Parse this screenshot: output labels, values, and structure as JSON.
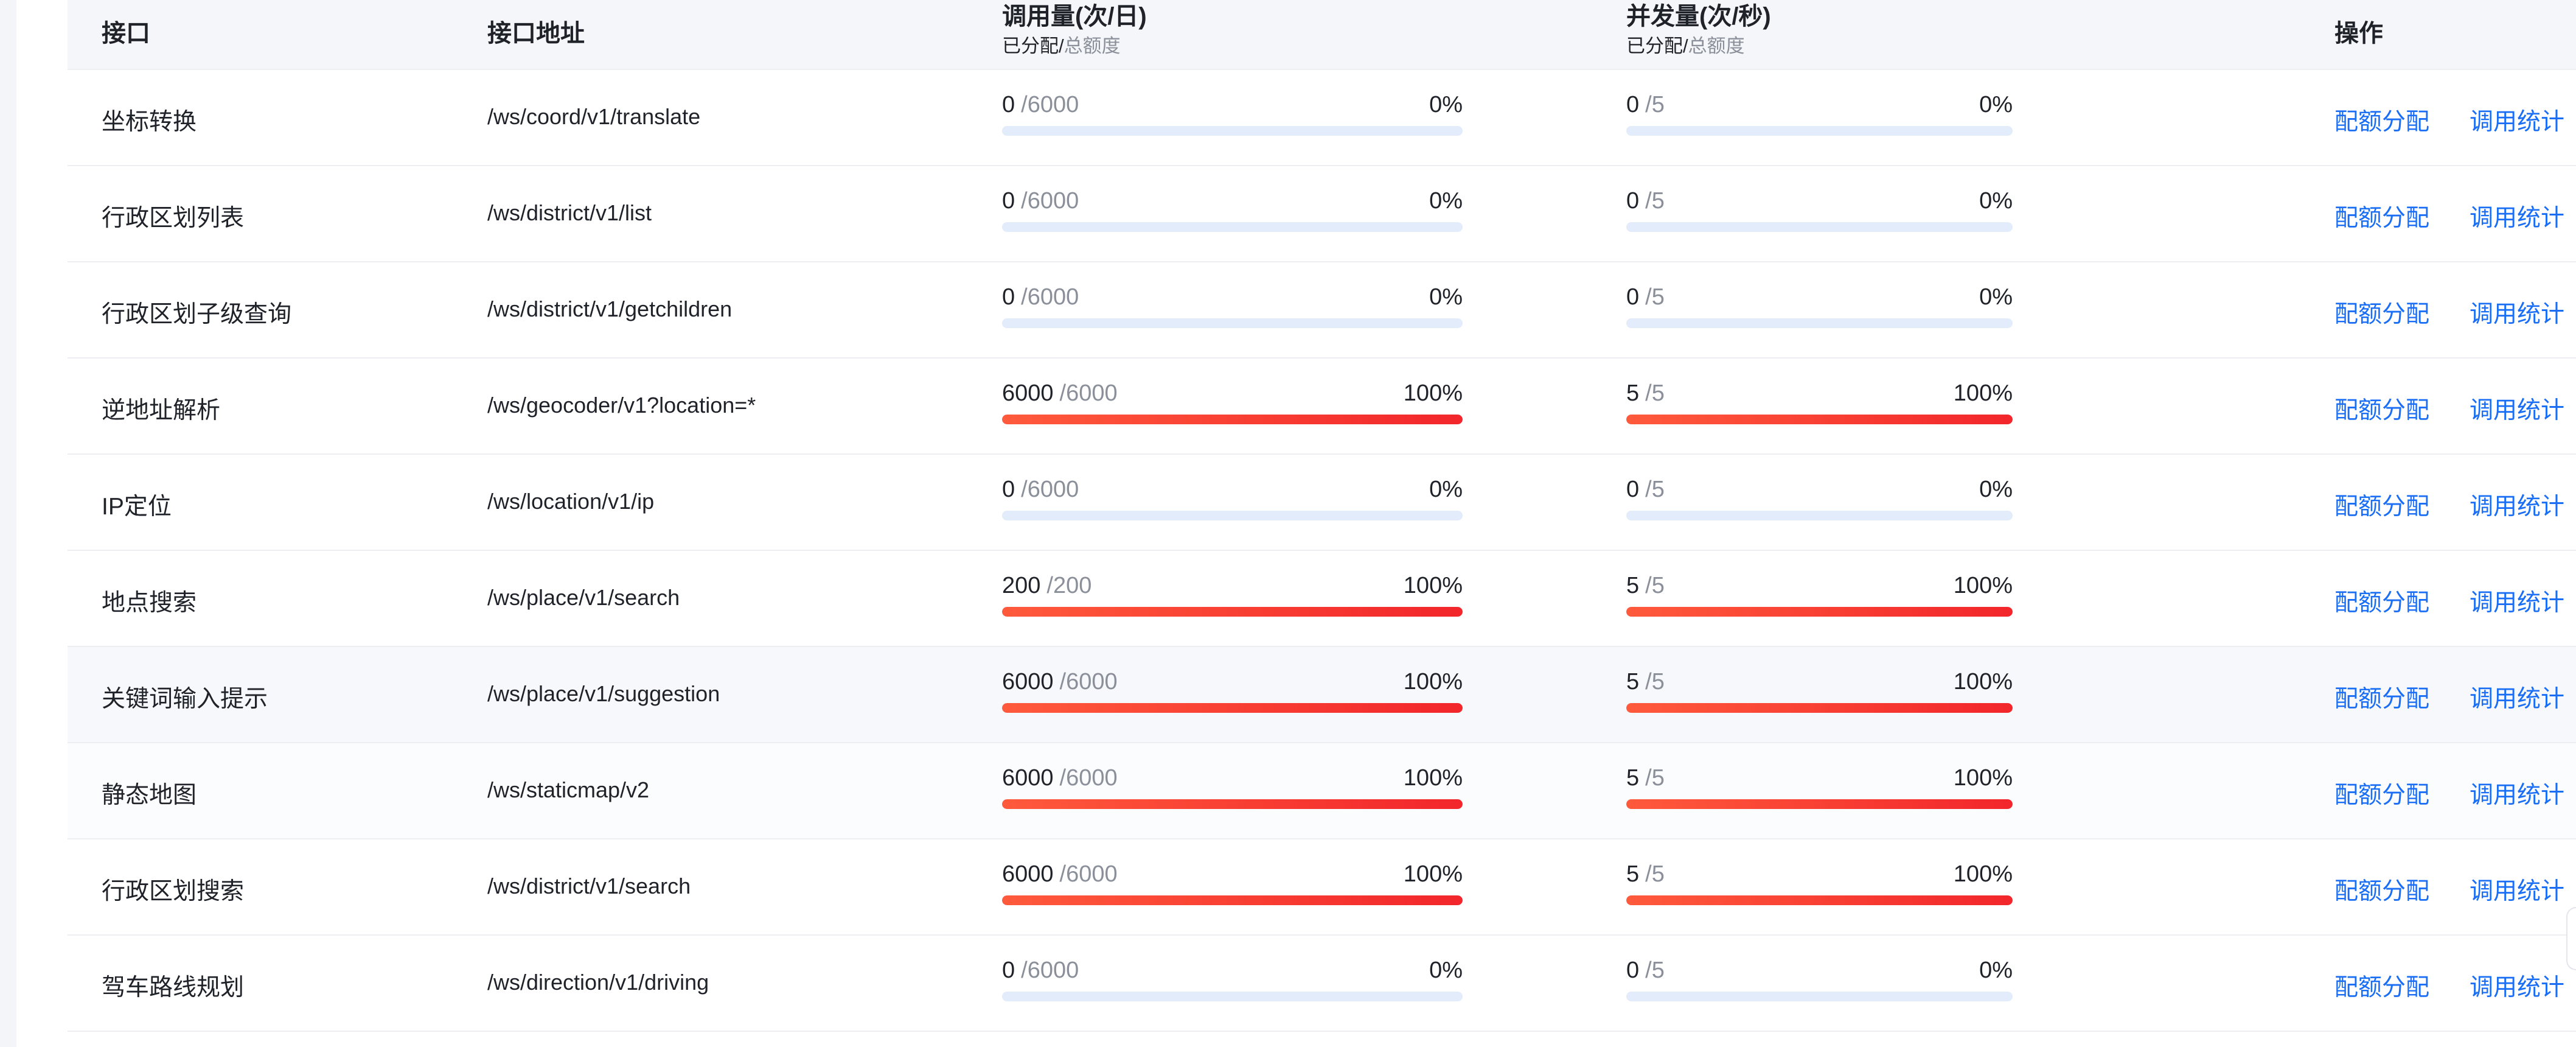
{
  "header": {
    "col_interface": "接口",
    "col_path": "接口地址",
    "col_calls_title": "调用量(次/日)",
    "col_calls_sub_a": "已分配/",
    "col_calls_sub_b": "总额度",
    "col_conc_title": "并发量(次/秒)",
    "col_conc_sub_a": "已分配/",
    "col_conc_sub_b": "总额度",
    "col_actions": "操作"
  },
  "actions": {
    "quota": "配额分配",
    "stats": "调用统计"
  },
  "colors": {
    "link": "#1a6ef5",
    "bar_full": "#f2262b",
    "bar_track": "#e3ecfb"
  },
  "rows": [
    {
      "name": "坐标转换",
      "path": "/ws/coord/v1/translate",
      "calls": {
        "used": "0",
        "total": "/6000",
        "pct": "0%",
        "ratio": 0
      },
      "conc": {
        "used": "0",
        "total": "/5",
        "pct": "0%",
        "ratio": 0
      }
    },
    {
      "name": "行政区划列表",
      "path": "/ws/district/v1/list",
      "calls": {
        "used": "0",
        "total": "/6000",
        "pct": "0%",
        "ratio": 0
      },
      "conc": {
        "used": "0",
        "total": "/5",
        "pct": "0%",
        "ratio": 0
      }
    },
    {
      "name": "行政区划子级查询",
      "path": "/ws/district/v1/getchildren",
      "calls": {
        "used": "0",
        "total": "/6000",
        "pct": "0%",
        "ratio": 0
      },
      "conc": {
        "used": "0",
        "total": "/5",
        "pct": "0%",
        "ratio": 0
      }
    },
    {
      "name": "逆地址解析",
      "path": "/ws/geocoder/v1?location=*",
      "calls": {
        "used": "6000",
        "total": "/6000",
        "pct": "100%",
        "ratio": 1
      },
      "conc": {
        "used": "5",
        "total": "/5",
        "pct": "100%",
        "ratio": 1
      }
    },
    {
      "name": "IP定位",
      "path": "/ws/location/v1/ip",
      "calls": {
        "used": "0",
        "total": "/6000",
        "pct": "0%",
        "ratio": 0
      },
      "conc": {
        "used": "0",
        "total": "/5",
        "pct": "0%",
        "ratio": 0
      }
    },
    {
      "name": "地点搜索",
      "path": "/ws/place/v1/search",
      "calls": {
        "used": "200",
        "total": "/200",
        "pct": "100%",
        "ratio": 1
      },
      "conc": {
        "used": "5",
        "total": "/5",
        "pct": "100%",
        "ratio": 1
      }
    },
    {
      "name": "关键词输入提示",
      "path": "/ws/place/v1/suggestion",
      "calls": {
        "used": "6000",
        "total": "/6000",
        "pct": "100%",
        "ratio": 1
      },
      "conc": {
        "used": "5",
        "total": "/5",
        "pct": "100%",
        "ratio": 1
      }
    },
    {
      "name": "静态地图",
      "path": "/ws/staticmap/v2",
      "calls": {
        "used": "6000",
        "total": "/6000",
        "pct": "100%",
        "ratio": 1
      },
      "conc": {
        "used": "5",
        "total": "/5",
        "pct": "100%",
        "ratio": 1
      }
    },
    {
      "name": "行政区划搜索",
      "path": "/ws/district/v1/search",
      "calls": {
        "used": "6000",
        "total": "/6000",
        "pct": "100%",
        "ratio": 1
      },
      "conc": {
        "used": "5",
        "total": "/5",
        "pct": "100%",
        "ratio": 1
      }
    },
    {
      "name": "驾车路线规划",
      "path": "/ws/direction/v1/driving",
      "calls": {
        "used": "0",
        "total": "/6000",
        "pct": "0%",
        "ratio": 0
      },
      "conc": {
        "used": "0",
        "total": "/5",
        "pct": "0%",
        "ratio": 0
      }
    }
  ]
}
